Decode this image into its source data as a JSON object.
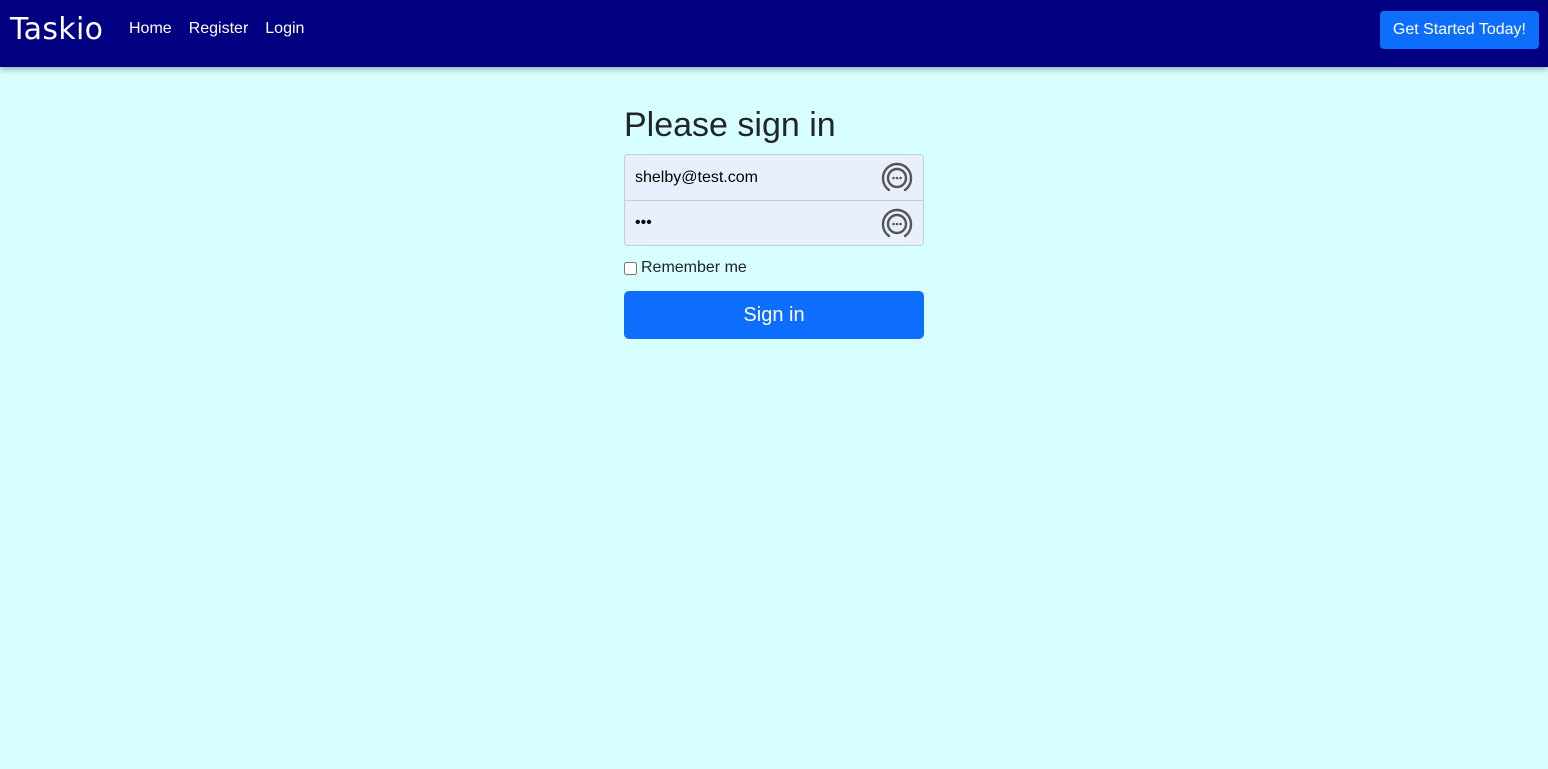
{
  "navbar": {
    "brand": "Taskio",
    "links": [
      "Home",
      "Register",
      "Login"
    ],
    "cta_label": "Get Started Today!"
  },
  "form": {
    "heading": "Please sign in",
    "email_value": "shelby@test.com",
    "password_value": "•••",
    "remember_label": "Remember me",
    "remember_checked": false,
    "submit_label": "Sign in"
  },
  "icons": {
    "field_icon": "password-manager-icon"
  },
  "colors": {
    "navbar_bg": "#000080",
    "page_bg": "#d7ffff",
    "primary": "#0d6efd",
    "autofill_bg": "#e8f0fe"
  }
}
